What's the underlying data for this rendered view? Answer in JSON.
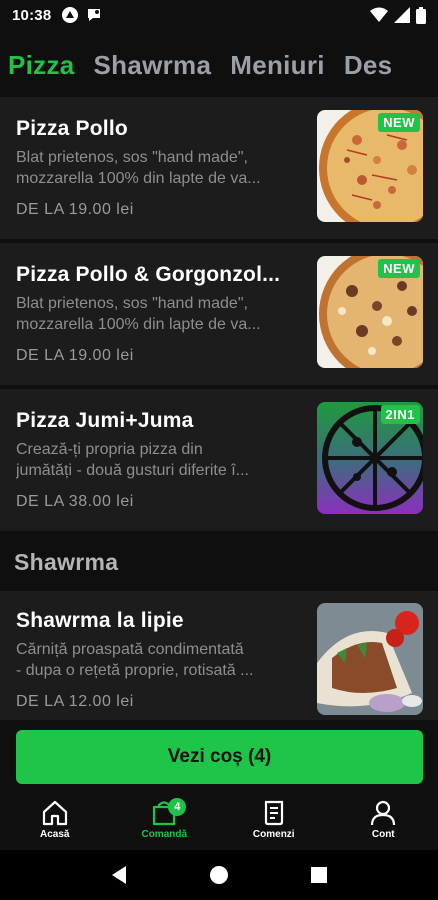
{
  "status_bar": {
    "time": "10:38"
  },
  "tabs": [
    {
      "label": "Pizza",
      "active": true
    },
    {
      "label": "Shawrma",
      "active": false
    },
    {
      "label": "Meniuri",
      "active": false
    },
    {
      "label": "Des",
      "active": false
    }
  ],
  "items": [
    {
      "title": "Pizza Pollo",
      "desc_line1": "Blat prietenos, sos \"hand made\",",
      "desc_line2": "mozzarella 100% din lapte de va...",
      "price": "DE LA 19.00 lei",
      "badge": "NEW",
      "image": "pizza-pollo-image"
    },
    {
      "title": "Pizza Pollo & Gorgonzol...",
      "desc_line1": "Blat prietenos, sos \"hand made\",",
      "desc_line2": "mozzarella 100% din lapte de va...",
      "price": "DE LA 19.00 lei",
      "badge": "NEW",
      "image": "pizza-pollo-gorgonzola-image"
    },
    {
      "title": "Pizza Jumi+Juma",
      "desc_line1": "Crează-ți propria pizza din",
      "desc_line2": "jumătăți - două gusturi diferite î...",
      "price": "DE LA 38.00 lei",
      "badge": "2IN1",
      "image": "pizza-half-half-image"
    }
  ],
  "section_shawrma": {
    "heading": "Shawrma",
    "items": [
      {
        "title": "Shawrma la lipie",
        "desc_line1": "Cărniță proaspată condimentată",
        "desc_line2": "- dupa o rețetă proprie, rotisată ...",
        "price": "DE LA 12.00 lei",
        "image": "shawrma-image"
      }
    ]
  },
  "cart_button": {
    "label": "Vezi coș (4)"
  },
  "bottom_nav": [
    {
      "label": "Acasă",
      "icon": "home-icon",
      "active": false
    },
    {
      "label": "Comandă",
      "icon": "shopping-bag-icon",
      "active": true,
      "badge": "4"
    },
    {
      "label": "Comenzi",
      "icon": "receipt-icon",
      "active": false
    },
    {
      "label": "Cont",
      "icon": "user-icon",
      "active": false
    }
  ],
  "colors": {
    "accent": "#20c24a",
    "background": "#0f0f0f",
    "card": "#1c1c1c"
  }
}
